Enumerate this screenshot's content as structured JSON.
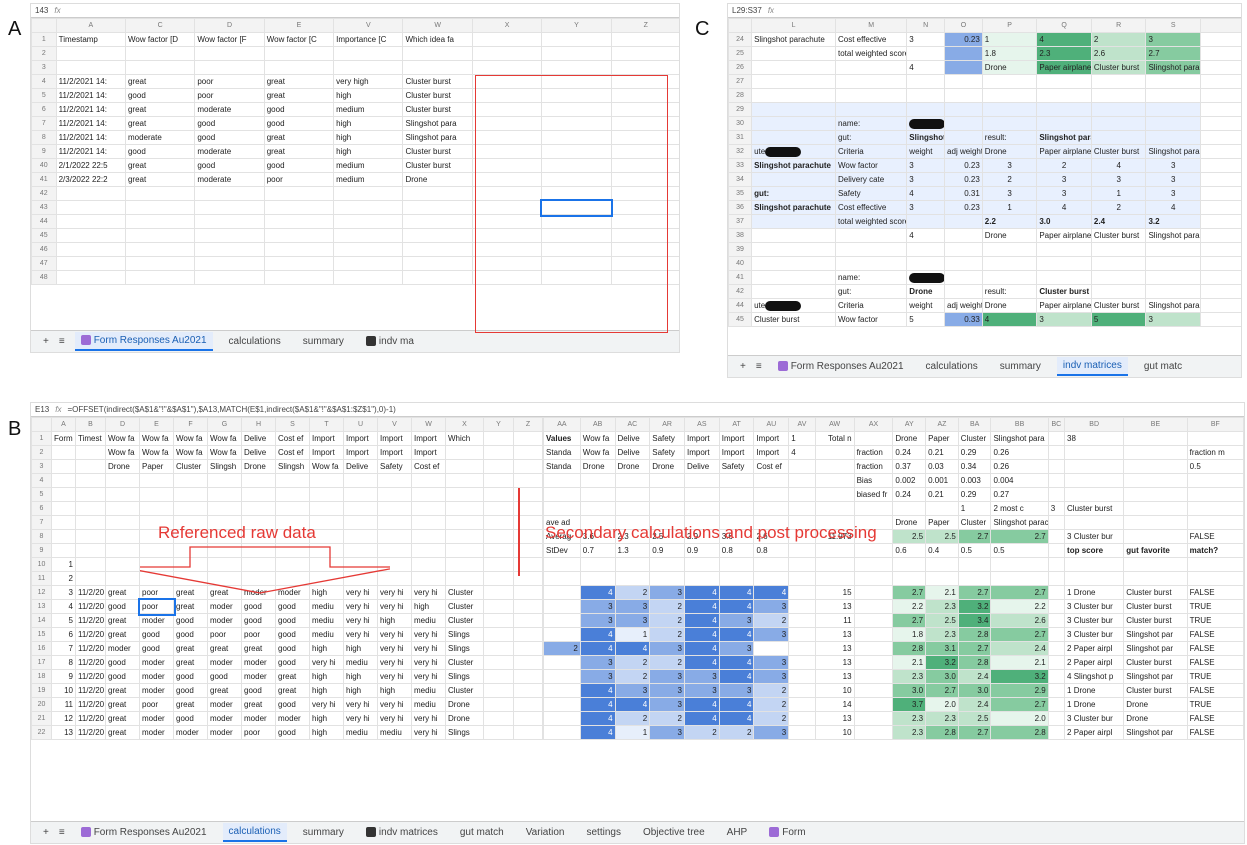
{
  "labels": {
    "a": "A",
    "b": "B",
    "c": "C"
  },
  "panelA": {
    "cellref": "143",
    "cols": [
      "A",
      "C",
      "D",
      "E",
      "V",
      "W",
      "X",
      "Y",
      "Z"
    ],
    "header": [
      "Timestamp",
      "Wow factor [D",
      "Wow factor [F",
      "Wow factor [C",
      "Importance [C",
      "Which idea fa",
      "",
      "",
      ""
    ],
    "rows": [
      {
        "n": "2",
        "c": [
          "",
          "",
          "",
          "",
          "",
          "",
          "",
          "",
          ""
        ]
      },
      {
        "n": "3",
        "c": [
          "",
          "",
          "",
          "",
          "",
          "",
          "",
          "",
          ""
        ]
      },
      {
        "n": "4",
        "c": [
          "11/2/2021 14:",
          "great",
          "poor",
          "great",
          "very high",
          "Cluster burst",
          "",
          "",
          ""
        ]
      },
      {
        "n": "5",
        "c": [
          "11/2/2021 14:",
          "good",
          "poor",
          "great",
          "high",
          "Cluster burst",
          "",
          "",
          ""
        ]
      },
      {
        "n": "6",
        "c": [
          "11/2/2021 14:",
          "great",
          "moderate",
          "good",
          "medium",
          "Cluster burst",
          "",
          "",
          ""
        ]
      },
      {
        "n": "7",
        "c": [
          "11/2/2021 14:",
          "great",
          "good",
          "good",
          "high",
          "Slingshot para",
          "",
          "",
          ""
        ]
      },
      {
        "n": "8",
        "c": [
          "11/2/2021 14:",
          "moderate",
          "good",
          "great",
          "high",
          "Slingshot para",
          "",
          "",
          ""
        ]
      },
      {
        "n": "9",
        "c": [
          "11/2/2021 14:",
          "good",
          "moderate",
          "great",
          "high",
          "Cluster burst",
          "",
          "",
          ""
        ]
      },
      {
        "n": "40",
        "c": [
          "2/1/2022 22:5",
          "great",
          "good",
          "good",
          "medium",
          "Cluster burst",
          "",
          "",
          ""
        ]
      },
      {
        "n": "41",
        "c": [
          "2/3/2022 22:2",
          "great",
          "moderate",
          "poor",
          "medium",
          "Drone",
          "",
          "",
          ""
        ]
      },
      {
        "n": "42",
        "c": [
          "",
          "",
          "",
          "",
          "",
          "",
          "",
          "",
          ""
        ]
      },
      {
        "n": "43",
        "c": [
          "",
          "",
          "",
          "",
          "",
          "",
          "",
          "",
          ""
        ]
      },
      {
        "n": "44",
        "c": [
          "",
          "",
          "",
          "",
          "",
          "",
          "",
          "",
          ""
        ]
      },
      {
        "n": "45",
        "c": [
          "",
          "",
          "",
          "",
          "",
          "",
          "",
          "",
          ""
        ]
      },
      {
        "n": "46",
        "c": [
          "",
          "",
          "",
          "",
          "",
          "",
          "",
          "",
          ""
        ]
      },
      {
        "n": "47",
        "c": [
          "",
          "",
          "",
          "",
          "",
          "",
          "",
          "",
          ""
        ]
      },
      {
        "n": "48",
        "c": [
          "",
          "",
          "",
          "",
          "",
          "",
          "",
          "",
          ""
        ]
      }
    ],
    "tabs": [
      "Form Responses Au2021",
      "calculations",
      "summary",
      "indv ma"
    ]
  },
  "panelC": {
    "cellref": "L29:S37",
    "cols": [
      "L",
      "M",
      "N",
      "O",
      "P",
      "Q",
      "R",
      "S"
    ],
    "top": [
      {
        "n": "24",
        "c": [
          "Slingshot parachute",
          "Cost effective",
          "3",
          "0.23",
          "1",
          "4",
          "2",
          "3"
        ]
      },
      {
        "n": "25",
        "c": [
          "",
          "total weighted scores:",
          "",
          "",
          "1.8",
          "2.3",
          "2.6",
          "2.7"
        ]
      },
      {
        "n": "26",
        "c": [
          "",
          "",
          "4",
          "",
          "Drone",
          "Paper airplane",
          "Cluster burst",
          "Slingshot parachute"
        ]
      }
    ],
    "name_label": "name:",
    "gut_label": "gut:",
    "result_label": "result:",
    "block1": {
      "gut": "Slingshot parach",
      "result": "Slingshot parachute"
    },
    "crit_header": [
      "Criteria",
      "weight",
      "adj weight",
      "Drone",
      "Paper airplane",
      "Cluster burst",
      "Slingshot parachute"
    ],
    "crit_rows": [
      {
        "lead": "Slingshot parachute",
        "c": [
          "Wow factor",
          "3",
          "0.23",
          "3",
          "2",
          "4",
          "3"
        ]
      },
      {
        "lead": "",
        "c": [
          "Delivery cate",
          "3",
          "0.23",
          "2",
          "3",
          "3",
          "3"
        ]
      },
      {
        "lead": "gut:",
        "c": [
          "Safety",
          "4",
          "0.31",
          "3",
          "3",
          "1",
          "3"
        ]
      },
      {
        "lead": "Slingshot parachute",
        "c": [
          "Cost effective",
          "3",
          "0.23",
          "1",
          "4",
          "2",
          "4"
        ]
      }
    ],
    "block1_total": [
      "total weighted scores:",
      "2.2",
      "3.0",
      "2.4",
      "3.2"
    ],
    "block1_foot": [
      "4",
      "Drone",
      "Paper airplane",
      "Cluster burst",
      "Slingshot parachute"
    ],
    "block2": {
      "gut": "Drone",
      "result": "Cluster burst"
    },
    "last_row": [
      "Cluster burst",
      "Wow factor",
      "5",
      "0.33",
      "4",
      "3",
      "5",
      "3"
    ],
    "ute": "ute",
    "tabs": [
      "Form Responses Au2021",
      "calculations",
      "summary",
      "indv matrices",
      "gut matc"
    ]
  },
  "panelB": {
    "cellref": "E13",
    "formula": "=OFFSET(indirect($A$1&\"!\"&$A$1\"),$A13,MATCH(E$1,indirect($A$1&\"!\"&$A$1:$Z$1\"),0)-1)",
    "left_cols": [
      "A",
      "B",
      "D",
      "E",
      "F",
      "G",
      "H",
      "S",
      "T",
      "U",
      "V",
      "W",
      "X",
      "Y",
      "Z"
    ],
    "right_cols": [
      "AA",
      "AB",
      "AC",
      "AR",
      "AS",
      "AT",
      "AU",
      "AV",
      "AW",
      "AX",
      "AY",
      "AZ",
      "BA",
      "BB",
      "BC",
      "BD",
      "BE",
      "BF"
    ],
    "left_rows": [
      [
        "1",
        "Form R",
        "Timest",
        "Wow fa",
        "Wow fa",
        "Wow fa",
        "Wow fa",
        "Delive",
        "Cost ef",
        "Import",
        "Import",
        "Import",
        "Import",
        "Which",
        "",
        ""
      ],
      [
        "2",
        "",
        "",
        "Wow fa",
        "Wow fa",
        "Wow fa",
        "Wow fa",
        "Delive",
        "Cost ef",
        "Import",
        "Import",
        "Import",
        "Import",
        "",
        "",
        ""
      ],
      [
        "3",
        "",
        "",
        "Drone",
        "Paper",
        "Cluster",
        "Slingsh",
        "Drone",
        "Slingsh",
        "Wow fa",
        "Delive",
        "Safety",
        "Cost ef",
        "",
        "",
        ""
      ],
      [
        "4",
        "",
        "",
        "",
        "",
        "",
        "",
        "",
        "",
        "",
        "",
        "",
        "",
        "",
        "",
        ""
      ],
      [
        "5",
        "",
        "",
        "",
        "",
        "",
        "",
        "",
        "",
        "",
        "",
        "",
        "",
        "",
        "",
        ""
      ],
      [
        "6",
        "",
        "",
        "",
        "",
        "",
        "",
        "",
        "",
        "",
        "",
        "",
        "",
        "",
        "",
        ""
      ],
      [
        "7",
        "",
        "",
        "",
        "",
        "",
        "",
        "",
        "",
        "",
        "",
        "",
        "",
        "",
        "",
        ""
      ],
      [
        "8",
        "",
        "",
        "",
        "",
        "",
        "",
        "",
        "",
        "",
        "",
        "",
        "",
        "",
        "",
        ""
      ],
      [
        "9",
        "",
        "",
        "",
        "",
        "",
        "",
        "",
        "",
        "",
        "",
        "",
        "",
        "",
        "",
        ""
      ],
      [
        "10",
        "1",
        "",
        "",
        "",
        "",
        "",
        "",
        "",
        "",
        "",
        "",
        "",
        "",
        "",
        ""
      ],
      [
        "11",
        "2",
        "",
        "",
        "",
        "",
        "",
        "",
        "",
        "",
        "",
        "",
        "",
        "",
        "",
        ""
      ],
      [
        "12",
        "3",
        "11/2/20",
        "great",
        "poor",
        "great",
        "great",
        "moder",
        "moder",
        "high",
        "very hi",
        "very hi",
        "very hi",
        "Cluster",
        "",
        ""
      ],
      [
        "13",
        "4",
        "11/2/20",
        "good",
        "poor",
        "great",
        "moder",
        "good",
        "good",
        "mediu",
        "very hi",
        "very hi",
        "high",
        "Cluster",
        "",
        ""
      ],
      [
        "14",
        "5",
        "11/2/20",
        "great",
        "moder",
        "good",
        "moder",
        "good",
        "good",
        "mediu",
        "very hi",
        "high",
        "mediu",
        "Cluster",
        "",
        ""
      ],
      [
        "15",
        "6",
        "11/2/20",
        "great",
        "good",
        "good",
        "poor",
        "poor",
        "good",
        "mediu",
        "very hi",
        "very hi",
        "very hi",
        "Slings",
        "",
        ""
      ],
      [
        "16",
        "7",
        "11/2/20",
        "moder",
        "good",
        "great",
        "great",
        "great",
        "good",
        "high",
        "high",
        "very hi",
        "very hi",
        "Slings",
        "",
        ""
      ],
      [
        "17",
        "8",
        "11/2/20",
        "good",
        "moder",
        "great",
        "moder",
        "moder",
        "good",
        "very hi",
        "mediu",
        "very hi",
        "very hi",
        "Cluster",
        "",
        ""
      ],
      [
        "18",
        "9",
        "11/2/20",
        "good",
        "moder",
        "good",
        "good",
        "moder",
        "great",
        "high",
        "high",
        "very hi",
        "very hi",
        "Slings",
        "",
        ""
      ],
      [
        "19",
        "10",
        "11/2/20",
        "great",
        "moder",
        "good",
        "great",
        "good",
        "great",
        "high",
        "high",
        "high",
        "mediu",
        "Cluster",
        "",
        ""
      ],
      [
        "20",
        "11",
        "11/2/20",
        "great",
        "poor",
        "great",
        "moder",
        "great",
        "good",
        "very hi",
        "very hi",
        "very hi",
        "mediu",
        "Drone",
        "",
        ""
      ],
      [
        "21",
        "12",
        "11/2/20",
        "great",
        "moder",
        "good",
        "moder",
        "moder",
        "moder",
        "high",
        "very hi",
        "very hi",
        "very hi",
        "Drone",
        "",
        ""
      ],
      [
        "22",
        "13",
        "11/2/20",
        "great",
        "moder",
        "moder",
        "moder",
        "poor",
        "good",
        "high",
        "mediu",
        "mediu",
        "very hi",
        "Slings",
        "",
        ""
      ]
    ],
    "right_rows": [
      [
        "Values",
        "Wow fa",
        "Delive",
        "Safety",
        "Import",
        "Import",
        "Import",
        "1",
        "Total n",
        "",
        "Drone",
        "Paper",
        "Cluster",
        "Slingshot para",
        "",
        "38",
        "",
        ""
      ],
      [
        "Standa",
        "Wow fa",
        "Delive",
        "Safety",
        "Import",
        "Import",
        "Import",
        "4",
        "",
        "fraction",
        "0.24",
        "0.21",
        "0.29",
        "0.26",
        "",
        "",
        "",
        "fraction m"
      ],
      [
        "Standa",
        "Drone",
        "Drone",
        "Drone",
        "Delive",
        "Safety",
        "Cost ef",
        "",
        "",
        "fraction",
        "0.37",
        "0.03",
        "0.34",
        "0.26",
        "",
        "",
        "",
        "0.5"
      ],
      [
        "",
        "",
        "",
        "",
        "",
        "",
        "",
        "",
        "",
        "Bias",
        "0.002",
        "0.001",
        "0.003",
        "0.004",
        "",
        "",
        "",
        ""
      ],
      [
        "",
        "",
        "",
        "",
        "",
        "",
        "",
        "",
        "",
        "biased fr",
        "0.24",
        "0.21",
        "0.29",
        "0.27",
        "",
        "",
        "",
        ""
      ],
      [
        "",
        "",
        "",
        "",
        "",
        "",
        "",
        "",
        "",
        "",
        "",
        "",
        "1",
        "2 most c",
        "3",
        "Cluster burst",
        "",
        ""
      ],
      [
        "ave ad",
        "",
        "",
        "",
        "",
        "",
        "",
        "",
        "",
        "",
        "Drone",
        "Paper",
        "Cluster",
        "Slingshot parachute",
        "",
        "",
        "",
        ""
      ],
      [
        "Averag",
        "3.6",
        "2.3",
        "2.5",
        "2.9",
        "3.6",
        "2.6",
        "",
        "11.973",
        "",
        "2.5",
        "2.5",
        "2.7",
        "2.7",
        "",
        "3 Cluster bur",
        "",
        "FALSE"
      ],
      [
        "StDev",
        "0.7",
        "1.3",
        "0.9",
        "0.9",
        "0.8",
        "0.8",
        "",
        "",
        "",
        "0.6",
        "0.4",
        "0.5",
        "0.5",
        "",
        "top score",
        "gut favorite",
        "match?"
      ],
      [
        "",
        "",
        "",
        "",
        "",
        "",
        "",
        "",
        "",
        "",
        "",
        "",
        "",
        "",
        "",
        "",
        "",
        ""
      ],
      [
        "",
        "",
        "",
        "",
        "",
        "",
        "",
        "",
        "",
        "",
        "",
        "",
        "",
        "",
        "",
        "",
        "",
        ""
      ],
      [
        "",
        "4",
        "2",
        "3",
        "4",
        "4",
        "4",
        "",
        "15",
        "",
        "2.7",
        "2.1",
        "2.7",
        "2.7",
        "",
        "1 Drone",
        "Cluster burst",
        "FALSE"
      ],
      [
        "",
        "3",
        "3",
        "2",
        "4",
        "4",
        "3",
        "",
        "13",
        "",
        "2.2",
        "2.3",
        "3.2",
        "2.2",
        "",
        "3 Cluster bur",
        "Cluster burst",
        "TRUE"
      ],
      [
        "",
        "3",
        "3",
        "2",
        "4",
        "3",
        "2",
        "",
        "11",
        "",
        "2.7",
        "2.5",
        "3.4",
        "2.6",
        "",
        "3 Cluster bur",
        "Cluster burst",
        "TRUE"
      ],
      [
        "",
        "4",
        "1",
        "2",
        "4",
        "4",
        "3",
        "",
        "13",
        "",
        "1.8",
        "2.3",
        "2.8",
        "2.7",
        "",
        "3 Cluster bur",
        "Slingshot par",
        "FALSE"
      ],
      [
        "2",
        "4",
        "4",
        "3",
        "4",
        "3",
        "",
        "",
        "13",
        "",
        "2.8",
        "3.1",
        "2.7",
        "2.4",
        "",
        "2 Paper airpl",
        "Slingshot par",
        "FALSE"
      ],
      [
        "",
        "3",
        "2",
        "2",
        "4",
        "4",
        "3",
        "",
        "13",
        "",
        "2.1",
        "3.2",
        "2.8",
        "2.1",
        "",
        "2 Paper airpl",
        "Cluster burst",
        "FALSE"
      ],
      [
        "",
        "3",
        "2",
        "3",
        "3",
        "4",
        "3",
        "",
        "13",
        "",
        "2.3",
        "3.0",
        "2.4",
        "3.2",
        "",
        "4 Slingshot p",
        "Slingshot par",
        "TRUE"
      ],
      [
        "",
        "4",
        "3",
        "3",
        "3",
        "3",
        "2",
        "",
        "10",
        "",
        "3.0",
        "2.7",
        "3.0",
        "2.9",
        "",
        "1 Drone",
        "Cluster burst",
        "FALSE"
      ],
      [
        "",
        "4",
        "4",
        "3",
        "4",
        "4",
        "2",
        "",
        "14",
        "",
        "3.7",
        "2.0",
        "2.4",
        "2.7",
        "",
        "1 Drone",
        "Drone",
        "TRUE"
      ],
      [
        "",
        "4",
        "2",
        "2",
        "4",
        "4",
        "2",
        "",
        "13",
        "",
        "2.3",
        "2.3",
        "2.5",
        "2.0",
        "",
        "3 Cluster bur",
        "Drone",
        "FALSE"
      ],
      [
        "",
        "4",
        "1",
        "3",
        "2",
        "2",
        "3",
        "",
        "10",
        "",
        "2.3",
        "2.8",
        "2.7",
        "2.8",
        "",
        "2 Paper airpl",
        "Slingshot par",
        "FALSE"
      ]
    ],
    "annot_left": "Referenced raw data",
    "annot_right": "Secondary calculations and post processing",
    "tabs": [
      "Form Responses Au2021",
      "calculations",
      "summary",
      "indv matrices",
      "gut match",
      "Variation",
      "settings",
      "Objective tree",
      "AHP",
      "Form"
    ]
  }
}
